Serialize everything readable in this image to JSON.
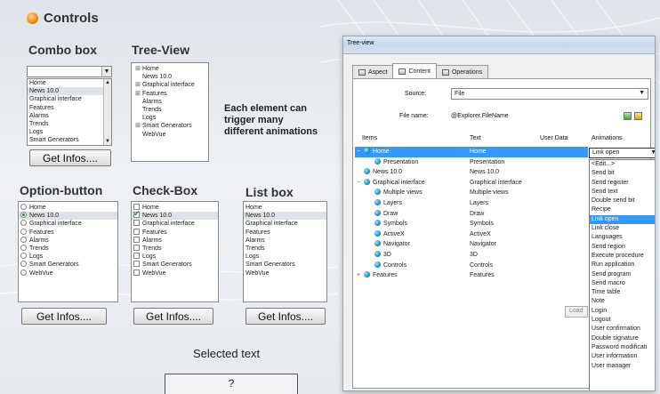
{
  "page": {
    "title": "Controls",
    "description_lines": [
      "Each element can",
      "trigger many",
      "different animations"
    ],
    "selected_text_label": "Selected text",
    "selected_text_value": "?"
  },
  "combo_box": {
    "heading": "Combo box",
    "value": "",
    "items": [
      "Home",
      "News 10.0",
      "Graphical interface",
      "Features",
      "Alarms",
      "Trends",
      "Logs",
      "Smart Generators"
    ],
    "selected_index": 1,
    "button_label": "Get Infos...."
  },
  "tree_view": {
    "heading": "Tree-View",
    "items": [
      {
        "label": "Home",
        "expander": "⊞"
      },
      {
        "label": "News 10.0",
        "expander": ""
      },
      {
        "label": "Graphical interface",
        "expander": "⊞"
      },
      {
        "label": "Features",
        "expander": "⊞"
      },
      {
        "label": "Alarms",
        "expander": ""
      },
      {
        "label": "Trends",
        "expander": ""
      },
      {
        "label": "Logs",
        "expander": ""
      },
      {
        "label": "Smart Generators",
        "expander": "⊞"
      },
      {
        "label": "WebVue",
        "expander": ""
      }
    ]
  },
  "option_button": {
    "heading": "Option-button",
    "items": [
      "Home",
      "News 10.0",
      "Graphical interface",
      "Features",
      "Alarms",
      "Trends",
      "Logs",
      "Smart Generators",
      "WebVue"
    ],
    "selected_index": 1,
    "button_label": "Get Infos...."
  },
  "check_box": {
    "heading": "Check-Box",
    "items": [
      "Home",
      "News 10.0",
      "Graphical interface",
      "Features",
      "Alarms",
      "Trends",
      "Logs",
      "Smart Generators",
      "WebVue"
    ],
    "checked_index": 1,
    "button_label": "Get Infos...."
  },
  "list_box": {
    "heading": "List box",
    "items": [
      "Home",
      "News 10.0",
      "Graphical interface",
      "Features",
      "Alarms",
      "Trends",
      "Logs",
      "Smart Generators",
      "WebVue"
    ],
    "selected_index": 1,
    "button_label": "Get Infos...."
  },
  "window": {
    "title": "Tree-view",
    "tabs": [
      {
        "label": "Aspect",
        "active": false
      },
      {
        "label": "Content",
        "active": true
      },
      {
        "label": "Operations",
        "active": false
      }
    ],
    "source_label": "Source:",
    "source_value": "File",
    "filename_label": "File name:",
    "filename_value": "@Explorer.FileName",
    "columns": [
      "Items",
      "Text",
      "User Data",
      "Animations"
    ],
    "rows": [
      {
        "item": "Home",
        "text": "Home",
        "expander": "−",
        "selected": true
      },
      {
        "item": "Presentation",
        "text": "Presentation",
        "expander": "",
        "selected": false
      },
      {
        "item": "News 10.0",
        "text": "News 10.0",
        "expander": "",
        "selected": false
      },
      {
        "item": "Graphical interface",
        "text": "Graphical interface",
        "expander": "−",
        "selected": false
      },
      {
        "item": "Multiple views",
        "text": "Multiple views",
        "expander": "",
        "selected": false
      },
      {
        "item": "Layers",
        "text": "Layers",
        "expander": "",
        "selected": false
      },
      {
        "item": "Draw",
        "text": "Draw",
        "expander": "",
        "selected": false
      },
      {
        "item": "Symbols",
        "text": "Symbols",
        "expander": "",
        "selected": false
      },
      {
        "item": "ActiveX",
        "text": "ActiveX",
        "expander": "",
        "selected": false
      },
      {
        "item": "Navigator",
        "text": "Navigator",
        "expander": "",
        "selected": false
      },
      {
        "item": "3D",
        "text": "3D",
        "expander": "",
        "selected": false
      },
      {
        "item": "Controls",
        "text": "Controls",
        "expander": "",
        "selected": false
      },
      {
        "item": "Features",
        "text": "Features",
        "expander": "+",
        "selected": false
      }
    ],
    "animation_value": "Link open",
    "animation_options": [
      "<Edit...>",
      "Send bit",
      "Send register",
      "Send text",
      "Double send bit",
      "Recipe",
      "Link open",
      "Link close",
      "Languages",
      "Send region",
      "Execute procedure",
      "Run application",
      "Send program",
      "Send macro",
      "Time table",
      "Note",
      "Login",
      "Logout",
      "User confirmation",
      "Double signature",
      "Password modificati",
      "User information",
      "User manager"
    ],
    "animation_highlight_index": 6,
    "load_button_label": "Load"
  },
  "colors": {
    "selection": "#3399ff",
    "accent_orb": "#f08a10"
  }
}
